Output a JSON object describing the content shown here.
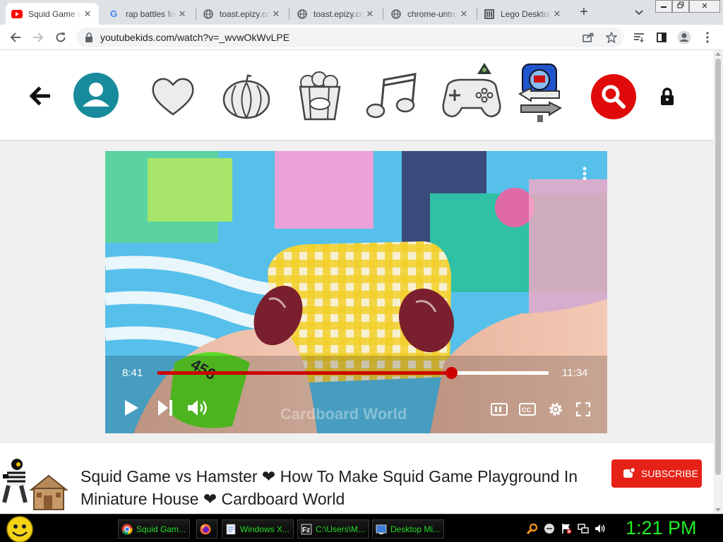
{
  "browser": {
    "tabs": [
      {
        "title": "Squid Game vs Hamster",
        "icon": "youtube-favicon",
        "active": true
      },
      {
        "title": "rap battles for kids",
        "icon": "google-favicon",
        "active": false
      },
      {
        "title": "toast.epizy.com",
        "icon": "globe-favicon",
        "active": false
      },
      {
        "title": "toast.epizy.com",
        "icon": "globe-favicon",
        "active": false
      },
      {
        "title": "chrome-untrusted",
        "icon": "globe-favicon",
        "active": false
      },
      {
        "title": "Lego Desktop",
        "icon": "museum-favicon",
        "active": false
      }
    ],
    "new_tab_label": "+",
    "url": "youtubekids.com/watch?v=_wvwOkWvLPE"
  },
  "kids_nav": {
    "icons": [
      "back-arrow-icon",
      "profile-icon",
      "heart-icon",
      "pumpkin-icon",
      "popcorn-icon",
      "music-note-icon",
      "game-controller-icon",
      "lego-nav-icon",
      "search-icon",
      "lock-icon"
    ]
  },
  "player": {
    "current_time": "8:41",
    "duration": "11:34",
    "progress": 0.751,
    "watermark": "Cardboard World",
    "wristband_text": "456"
  },
  "video": {
    "title": "Squid Game vs Hamster ❤ How To Make Squid Game Playground In Miniature House ❤ Cardboard World",
    "subscribe_label": "SUBSCRIBE"
  },
  "taskbar": {
    "items": [
      {
        "label": "Squid Gam...",
        "icon": "chrome-icon"
      },
      {
        "label": "",
        "icon": "firefox-icon"
      },
      {
        "label": "Windows X...",
        "icon": "notepad-icon"
      },
      {
        "label": "C:\\Users\\M...",
        "icon": "filezilla-icon"
      },
      {
        "label": "Desktop Mi...",
        "icon": "desktop-minifig-icon"
      }
    ],
    "clock": "1:21 PM"
  },
  "colors": {
    "accent_red": "#e62117",
    "progress_red": "#cc0000",
    "taskbar_green": "#22dd22",
    "profile_teal": "#178b9c"
  }
}
